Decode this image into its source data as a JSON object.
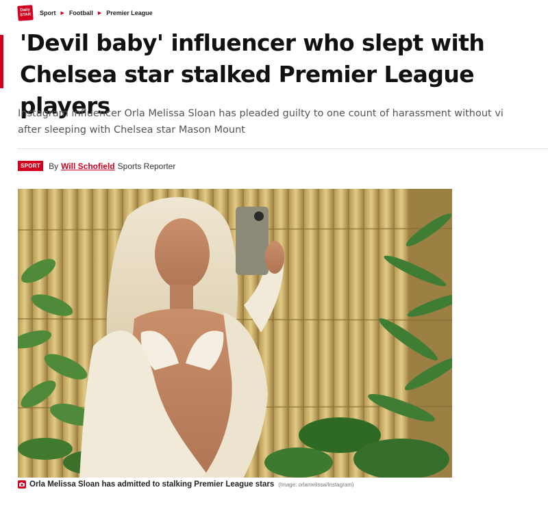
{
  "brand": {
    "logo_top": "Daily",
    "logo_bottom": "STAR",
    "accent_color": "#d1001f"
  },
  "breadcrumb": [
    "Sport",
    "Football",
    "Premier League"
  ],
  "headline": "'Devil baby' influencer who slept with Chelsea star stalked Premier League players",
  "standfirst": "Instagram influencer Orla Melissa Sloan has pleaded guilty to one count of harassment without vi\nafter sleeping with Chelsea star Mason Mount",
  "byline": {
    "badge": "SPORT",
    "prefix": "By",
    "author": "Will Schofield",
    "role": "Sports Reporter"
  },
  "image": {
    "caption": "Orla Melissa Sloan has admitted to stalking Premier League stars",
    "credit": "(Image: orlamelissa/Instagram)"
  },
  "icons": {
    "caption_icon": "camera-icon",
    "breadcrumb_separator": "chevron-right-icon"
  }
}
